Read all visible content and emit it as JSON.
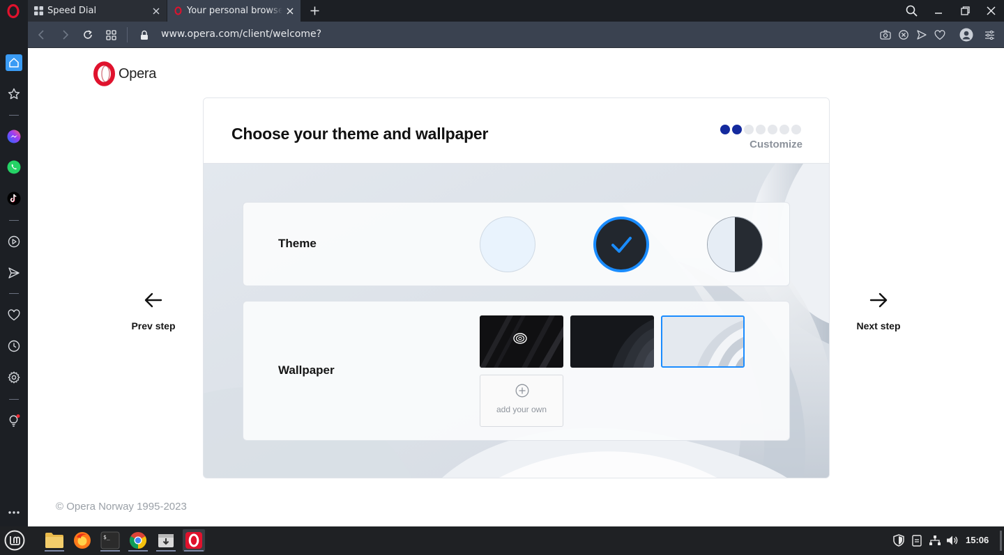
{
  "tabs": [
    {
      "title": "Speed Dial",
      "icon": "speed-dial-icon",
      "active": false
    },
    {
      "title": "Your personal browser is ready",
      "icon": "opera-icon",
      "active": true
    }
  ],
  "address_bar": {
    "url": "www.opera.com/client/welcome?"
  },
  "page": {
    "logo_text": "Opera",
    "card_title": "Choose your theme and wallpaper",
    "progress": {
      "total_steps": 7,
      "current_step": 2,
      "step_label": "Customize"
    },
    "theme": {
      "label": "Theme",
      "options": [
        "light",
        "dark",
        "auto"
      ],
      "selected": "dark"
    },
    "wallpaper": {
      "label": "Wallpaper",
      "options": [
        "opera-dark-logo",
        "dark-waves",
        "light-waves"
      ],
      "selected": "light-waves",
      "add_own_label": "add your own"
    },
    "prev_label": "Prev step",
    "next_label": "Next step",
    "footer": "© Opera Norway 1995-2023"
  },
  "sidebar": {
    "items": [
      "home-icon",
      "bookmarks-icon",
      "messenger-icon",
      "whatsapp-icon",
      "tiktok-icon",
      "player-icon",
      "send-icon",
      "heart-icon",
      "history-icon",
      "settings-icon",
      "tips-icon",
      "more-icon"
    ]
  },
  "taskbar": {
    "apps": [
      "mint-menu-icon",
      "files-icon",
      "firefox-icon",
      "terminal-icon",
      "chrome-icon",
      "archive-manager-icon",
      "opera-icon"
    ],
    "clock": "15:06"
  },
  "colors": {
    "accent_blue": "#1a8cff",
    "progress_blue": "#142a9e",
    "chrome_dark": "#1c1f24",
    "address_bar": "#3a4250"
  }
}
